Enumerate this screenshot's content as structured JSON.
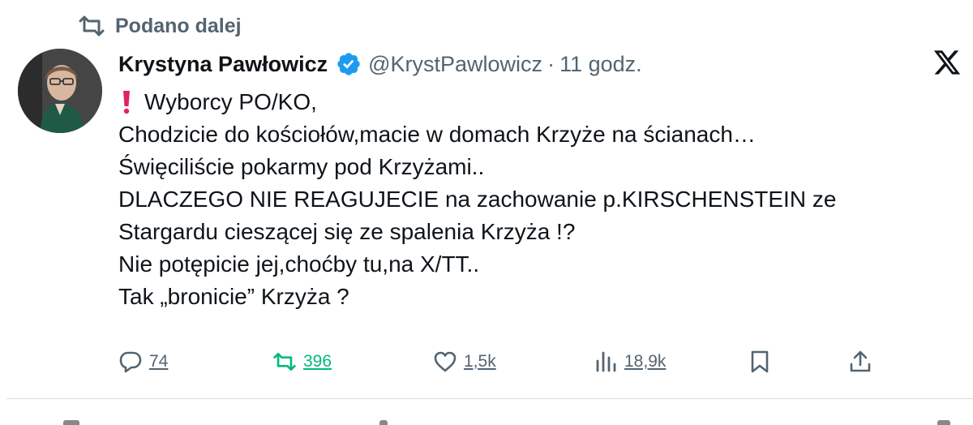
{
  "repost": {
    "label": "Podano dalej",
    "icon": "retweet-icon"
  },
  "author": {
    "name": "Krystyna Pawłowicz",
    "handle": "@KrystPawlowicz",
    "separator": "·",
    "time": "11 godz.",
    "verified_color": "#1d9bf0"
  },
  "tweet": {
    "lines": [
      "Wyborcy PO/KO,",
      "Chodzicie do kościołów,macie w domach Krzyże na ścianach…",
      "Święciliście pokarmy pod Krzyżami..",
      "DLACZEGO NIE REAGUJECIE na zachowanie p.KIRSCHENSTEIN ze",
      "Stargardu cieszącej się ze spalenia Krzyża !?",
      "Nie potępicie jej,choćby tu,na X/TT..",
      "Tak „bronicie” Krzyża ?"
    ]
  },
  "actions": {
    "replies": "74",
    "reposts": "396",
    "likes": "1,5k",
    "views": "18,9k"
  },
  "colors": {
    "text": "#0f1419",
    "muted": "#536471",
    "repost_active": "#00ba7c",
    "exclamation": "#e0245e"
  }
}
